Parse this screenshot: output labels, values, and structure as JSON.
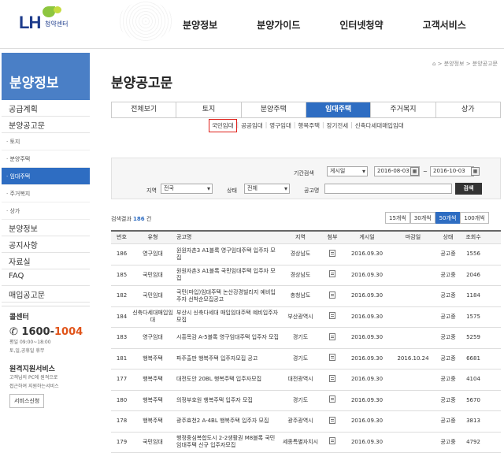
{
  "header": {
    "logo_text": "LH",
    "logo_sub": "청약센터",
    "nav": [
      "분양정보",
      "분양가이드",
      "인터넷청약",
      "고객서비스"
    ]
  },
  "sidebar": {
    "title": "분양정보",
    "items": [
      {
        "label": "공급계획",
        "type": "main"
      },
      {
        "label": "분양공고문",
        "type": "main"
      },
      {
        "label": "· 토지",
        "type": "sub"
      },
      {
        "label": "· 분양주택",
        "type": "sub"
      },
      {
        "label": "· 임대주택",
        "type": "sub",
        "active": true
      },
      {
        "label": "· 주거복지",
        "type": "sub"
      },
      {
        "label": "· 상가",
        "type": "sub"
      },
      {
        "label": "분양정보",
        "type": "main"
      },
      {
        "label": "공지사항",
        "type": "main"
      },
      {
        "label": "자료실",
        "type": "main"
      },
      {
        "label": "FAQ",
        "type": "main"
      },
      {
        "label": "매입공고문",
        "type": "main"
      }
    ],
    "callcenter": {
      "title": "콜센터",
      "phone_prefix": "1600-",
      "phone_suffix": "1004",
      "hours": "평일 09:00~18:00",
      "closed": "토,일,공휴일 휴무"
    },
    "remote": {
      "title": "원격지원서비스",
      "desc1": "고객님의 PC에 원격으로",
      "desc2": "접근하여 지원하는서비스",
      "button": "서비스신청"
    }
  },
  "content": {
    "breadcrumb": "⌂ > 분양정보 > 분양공고문",
    "title": "분양공고문",
    "tabs": [
      "전체보기",
      "토지",
      "분양주택",
      "임대주택",
      "주거복지",
      "상가"
    ],
    "active_tab": 3,
    "subtabs": [
      "국민임대",
      "공공임대",
      "영구임대",
      "행복주택",
      "장기전세",
      "신축다세대매입임대"
    ],
    "active_subtab": 0
  },
  "search": {
    "period_label": "기간검색",
    "period_select": "게시일",
    "date_from": "2016-08-03",
    "date_sep": "~",
    "date_to": "2016-10-03",
    "region_label": "지역",
    "region_select": "전국",
    "status_label": "상태",
    "status_select": "전체",
    "name_label": "공고명",
    "name_value": "",
    "button": "검색"
  },
  "result": {
    "prefix": "검색결과",
    "count": "186",
    "suffix": "건",
    "page_sizes": [
      "15개씩",
      "30개씩",
      "50개씩",
      "100개씩"
    ],
    "active_size": 2
  },
  "table": {
    "headers": [
      "번호",
      "유형",
      "공고명",
      "지역",
      "첨부",
      "게시일",
      "마감일",
      "상태",
      "조회수"
    ],
    "rows": [
      {
        "no": "186",
        "type": "영구임대",
        "title": "원원자촌3 A1블록 영구임대주택 입주자 모집",
        "region": "경상남도",
        "posted": "2016.09.30",
        "due": "",
        "status": "공고중",
        "views": "1556"
      },
      {
        "no": "185",
        "type": "국민임대",
        "title": "원원자촌3 A1블록 국민임대주택 입주자 모집",
        "region": "경상남도",
        "posted": "2016.09.30",
        "due": "",
        "status": "공고중",
        "views": "2046"
      },
      {
        "no": "182",
        "type": "국민임대",
        "title": "국민(마입)임대주택 논산강경빌리지 예비입주자 선착순모집공고",
        "region": "충청남도",
        "posted": "2016.09.30",
        "due": "",
        "status": "공고중",
        "views": "1184"
      },
      {
        "no": "184",
        "type": "신축다세대매입임대",
        "title": "부산시 신축다세대 매입임대주택 예비입주자 모집",
        "region": "부산광역시",
        "posted": "2016.09.30",
        "due": "",
        "status": "공고중",
        "views": "1575"
      },
      {
        "no": "183",
        "type": "영구임대",
        "title": "시흥목감 A-5블록 영구임대주택 입주자 모집",
        "region": "경기도",
        "posted": "2016.09.30",
        "due": "",
        "status": "공고중",
        "views": "5259"
      },
      {
        "no": "181",
        "type": "행복주택",
        "title": "파주출판 행복주택 입주자모집 공고",
        "region": "경기도",
        "posted": "2016.09.30",
        "due": "2016.10.24",
        "status": "공고중",
        "views": "6681"
      },
      {
        "no": "177",
        "type": "행복주택",
        "title": "대전도안 20BL 행복주택 입주자모집",
        "region": "대전광역시",
        "posted": "2016.09.30",
        "due": "",
        "status": "공고중",
        "views": "4104"
      },
      {
        "no": "180",
        "type": "행복주택",
        "title": "의정부호원 행복주택 입주자 모집",
        "region": "경기도",
        "posted": "2016.09.30",
        "due": "",
        "status": "공고중",
        "views": "5670"
      },
      {
        "no": "178",
        "type": "행복주택",
        "title": "광주효천2 A-4BL 행복주택 입주자 모집",
        "region": "광주광역시",
        "posted": "2016.09.30",
        "due": "",
        "status": "공고중",
        "views": "3813"
      },
      {
        "no": "179",
        "type": "국민임대",
        "title": "행정중심복합도시 2-2생활권 M8블록 국민임대주택 신규 입주자모집",
        "region": "세종특별자치시",
        "posted": "2016.09.30",
        "due": "",
        "status": "공고중",
        "views": "4792"
      }
    ]
  }
}
